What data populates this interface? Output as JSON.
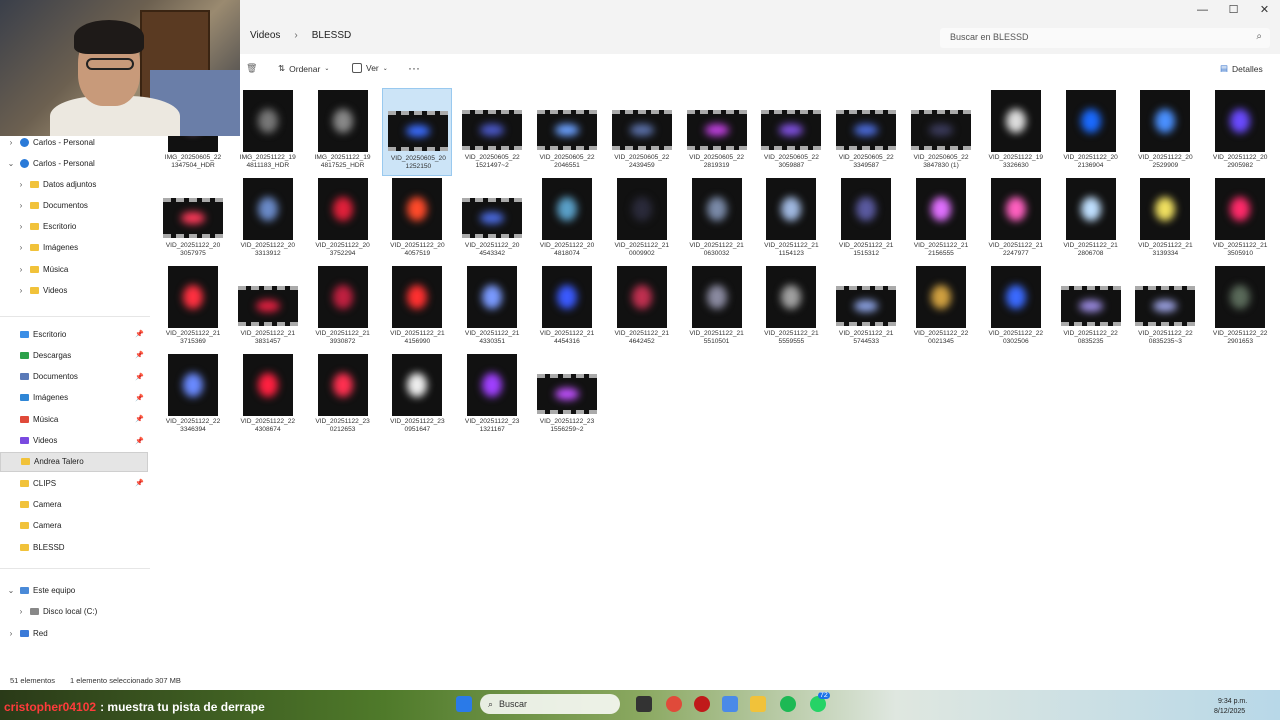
{
  "breadcrumb": [
    "Videos",
    "BLESSD"
  ],
  "search_placeholder": "Buscar en BLESSD",
  "toolbar": {
    "sort": "Ordenar",
    "view": "Ver",
    "more": "···",
    "details": "Detalles"
  },
  "window_controls": [
    "—",
    "☐",
    "✕"
  ],
  "sidebar": {
    "top_items": [
      {
        "label": "Carlos - Personal",
        "icon": "cloud-icon",
        "expanded": false
      },
      {
        "label": "Carlos - Personal",
        "icon": "cloud-icon",
        "expanded": true
      }
    ],
    "sub_items": [
      "Datos adjuntos",
      "Documentos",
      "Escritorio",
      "Imágenes",
      "Música",
      "Videos"
    ],
    "quick_access": [
      {
        "label": "Escritorio",
        "color": "#3a8ee6"
      },
      {
        "label": "Descargas",
        "color": "#2ba14a"
      },
      {
        "label": "Documentos",
        "color": "#5a7ab8"
      },
      {
        "label": "Imágenes",
        "color": "#2f86d6"
      },
      {
        "label": "Música",
        "color": "#e04a3a"
      },
      {
        "label": "Videos",
        "color": "#7a4ae0"
      },
      {
        "label": "Andrea Talero",
        "color": "#f1c23a"
      },
      {
        "label": "CLIPS",
        "color": "#f1c23a"
      },
      {
        "label": "Camera",
        "color": "#f1c23a"
      },
      {
        "label": "Camera",
        "color": "#f1c23a"
      },
      {
        "label": "BLESSD",
        "color": "#f1c23a"
      }
    ],
    "this_pc": "Este equipo",
    "local_disk": "Disco local (C:)",
    "network": "Red"
  },
  "files": [
    {
      "name": "IMG_20250605_22\n1347504_HDR",
      "kind": "portrait",
      "color": "#b085c0"
    },
    {
      "name": "IMG_20251122_19\n4811183_HDR",
      "kind": "portrait",
      "color": "#777777"
    },
    {
      "name": "IMG_20251122_19\n4817525_HDR",
      "kind": "portrait",
      "color": "#888888"
    },
    {
      "name": "VID_20250605_20\n1252150",
      "kind": "land",
      "color": "#3a6cff",
      "selected": true
    },
    {
      "name": "VID_20250605_22\n1521497~2",
      "kind": "land",
      "color": "#4a58c8"
    },
    {
      "name": "VID_20250605_22\n2046551",
      "kind": "land",
      "color": "#6aa0ff"
    },
    {
      "name": "VID_20250605_22\n2439459",
      "kind": "land",
      "color": "#5a70a8"
    },
    {
      "name": "VID_20250605_22\n2819319",
      "kind": "land",
      "color": "#c040e0"
    },
    {
      "name": "VID_20250605_22\n3059887",
      "kind": "land",
      "color": "#8050e0"
    },
    {
      "name": "VID_20250605_22\n3349587",
      "kind": "land",
      "color": "#4a6ad8"
    },
    {
      "name": "VID_20250605_22\n3847830 (1)",
      "kind": "land",
      "color": "#3a3a5a"
    },
    {
      "name": "VID_20251122_19\n3326630",
      "kind": "portrait",
      "color": "#dddddd"
    },
    {
      "name": "VID_20251122_20\n2136904",
      "kind": "portrait",
      "color": "#1a6aff"
    },
    {
      "name": "VID_20251122_20\n2529909",
      "kind": "portrait",
      "color": "#4a90ff"
    },
    {
      "name": "VID_20251122_20\n2905982",
      "kind": "portrait",
      "color": "#6a4aff"
    },
    {
      "name": "VID_20251122_20\n3057975",
      "kind": "land",
      "color": "#ff3a5a"
    },
    {
      "name": "VID_20251122_20\n3313912",
      "kind": "portrait",
      "color": "#6a8ac8"
    },
    {
      "name": "VID_20251122_20\n3752294",
      "kind": "portrait",
      "color": "#e0203a"
    },
    {
      "name": "VID_20251122_20\n4057519",
      "kind": "portrait",
      "color": "#ff4a2a"
    },
    {
      "name": "VID_20251122_20\n4543342",
      "kind": "land",
      "color": "#4a6ae0"
    },
    {
      "name": "VID_20251122_20\n4818074",
      "kind": "portrait",
      "color": "#5aa0c8"
    },
    {
      "name": "VID_20251122_21\n0009902",
      "kind": "portrait",
      "color": "#2a2a3a"
    },
    {
      "name": "VID_20251122_21\n0630032",
      "kind": "portrait",
      "color": "#7a8aa8"
    },
    {
      "name": "VID_20251122_21\n1154123",
      "kind": "portrait",
      "color": "#a0b8e0"
    },
    {
      "name": "VID_20251122_21\n1515312",
      "kind": "portrait",
      "color": "#5a5aa0"
    },
    {
      "name": "VID_20251122_21\n2156555",
      "kind": "portrait",
      "color": "#e070ff"
    },
    {
      "name": "VID_20251122_21\n2247977",
      "kind": "portrait",
      "color": "#ff60c0"
    },
    {
      "name": "VID_20251122_21\n2806708",
      "kind": "portrait",
      "color": "#c0e0ff"
    },
    {
      "name": "VID_20251122_21\n3139334",
      "kind": "portrait",
      "color": "#f0e060"
    },
    {
      "name": "VID_20251122_21\n3505910",
      "kind": "portrait",
      "color": "#ff2a6a"
    },
    {
      "name": "VID_20251122_21\n3715369",
      "kind": "portrait",
      "color": "#ff3040"
    },
    {
      "name": "VID_20251122_21\n3831457",
      "kind": "land",
      "color": "#e02040"
    },
    {
      "name": "VID_20251122_21\n3930872",
      "kind": "portrait",
      "color": "#c02040"
    },
    {
      "name": "VID_20251122_21\n4156990",
      "kind": "portrait",
      "color": "#ff3030"
    },
    {
      "name": "VID_20251122_21\n4330351",
      "kind": "portrait",
      "color": "#7a9aff"
    },
    {
      "name": "VID_20251122_21\n4454316",
      "kind": "portrait",
      "color": "#3a5aff"
    },
    {
      "name": "VID_20251122_21\n4642452",
      "kind": "portrait",
      "color": "#c03050"
    },
    {
      "name": "VID_20251122_21\n5510501",
      "kind": "portrait",
      "color": "#8a8aa0"
    },
    {
      "name": "VID_20251122_21\n5559555",
      "kind": "portrait",
      "color": "#a0a0a0"
    },
    {
      "name": "VID_20251122_21\n5744533",
      "kind": "land",
      "color": "#8aa0e0"
    },
    {
      "name": "VID_20251122_22\n0021345",
      "kind": "portrait",
      "color": "#d0a040"
    },
    {
      "name": "VID_20251122_22\n0302506",
      "kind": "portrait",
      "color": "#3a6aff"
    },
    {
      "name": "VID_20251122_22\n0835235",
      "kind": "land",
      "color": "#9a8ae0"
    },
    {
      "name": "VID_20251122_22\n0835235~3",
      "kind": "land",
      "color": "#9aa0e0"
    },
    {
      "name": "VID_20251122_22\n2901653",
      "kind": "portrait",
      "color": "#5a6a5a"
    },
    {
      "name": "VID_20251122_22\n3346394",
      "kind": "portrait",
      "color": "#6a8aff"
    },
    {
      "name": "VID_20251122_22\n4308674",
      "kind": "portrait",
      "color": "#ff2040"
    },
    {
      "name": "VID_20251122_23\n0212653",
      "kind": "portrait",
      "color": "#ff3050"
    },
    {
      "name": "VID_20251122_23\n0951647",
      "kind": "portrait",
      "color": "#eeeeee"
    },
    {
      "name": "VID_20251122_23\n1321167",
      "kind": "portrait",
      "color": "#a040ff"
    },
    {
      "name": "VID_20251122_23\n1556259~2",
      "kind": "land",
      "color": "#c050ff"
    }
  ],
  "status": {
    "count": "51 elementos",
    "selected": "1 elemento seleccionado  307 MB"
  },
  "chat": {
    "user": "cristopher04102",
    "message": ": muestra tu pista de derrape"
  },
  "taskbar": {
    "search": "Buscar",
    "badge": "72",
    "time": "9:34 p.m.",
    "date": "8/12/2025"
  }
}
